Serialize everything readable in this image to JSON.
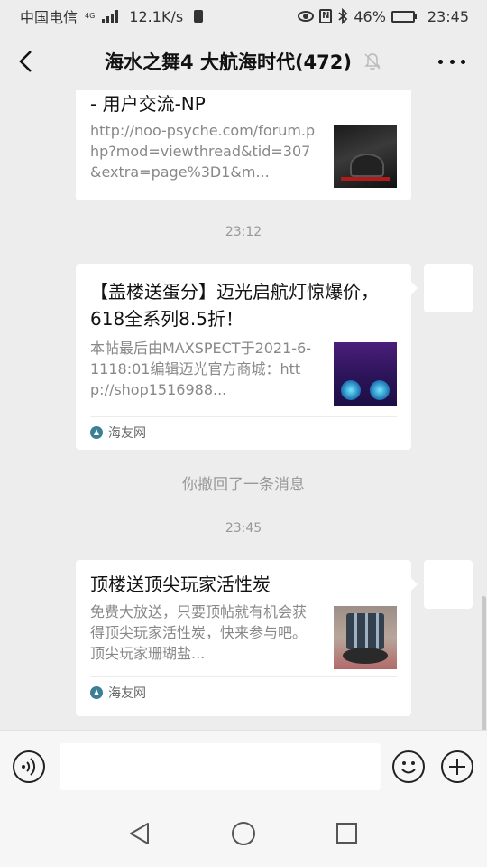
{
  "status_bar": {
    "carrier": "中国电信",
    "network_type": "4G",
    "speed": "12.1K/s",
    "battery": "46%",
    "battery_level": 0.46,
    "time": "23:45",
    "icons": [
      "signal-icon",
      "sim-icon",
      "eye-icon",
      "nfc-icon",
      "bluetooth-icon",
      "battery-icon"
    ]
  },
  "header": {
    "title": "海水之舞4 大航海时代(472)",
    "back_icon": "chevron-left-icon",
    "mute_icon": "bell-off-icon",
    "more_icon": "more-dots-icon"
  },
  "messages": [
    {
      "type": "link_card",
      "title": "- 用户交流-NP",
      "description": "http://noo-psyche.com/forum.php?mod=viewthread&tid=307&extra=page%3D1&m...",
      "thumbnail": "thumbnail-image"
    },
    {
      "type": "timestamp",
      "text": "23:12"
    },
    {
      "type": "link_card",
      "title": "【盖楼送蛋分】迈光启航灯惊爆价，618全系列8.5折！",
      "description": "本帖最后由MAXSPECT于2021-6-1118:01编辑迈光官方商城：http://shop1516988...",
      "source": "海友网",
      "thumbnail": "thumbnail-image"
    },
    {
      "type": "system",
      "text": "你撤回了一条消息"
    },
    {
      "type": "timestamp",
      "text": "23:45"
    },
    {
      "type": "link_card",
      "title": "顶楼送顶尖玩家活性炭",
      "description": "免费大放送，只要顶帖就有机会获得顶尖玩家活性炭，快来参与吧。顶尖玩家珊瑚盐...",
      "source": "海友网",
      "thumbnail": "thumbnail-image"
    }
  ],
  "input_bar": {
    "value": "",
    "voice_icon": "voice-icon",
    "emoji_icon": "emoji-icon",
    "plus_icon": "plus-icon"
  },
  "nav_bar": {
    "icons": [
      "nav-back-icon",
      "nav-home-icon",
      "nav-recent-icon"
    ]
  },
  "colors": {
    "background": "#ededed",
    "card": "#ffffff",
    "muted_text": "#888888",
    "source_icon": "#3a7f95"
  }
}
